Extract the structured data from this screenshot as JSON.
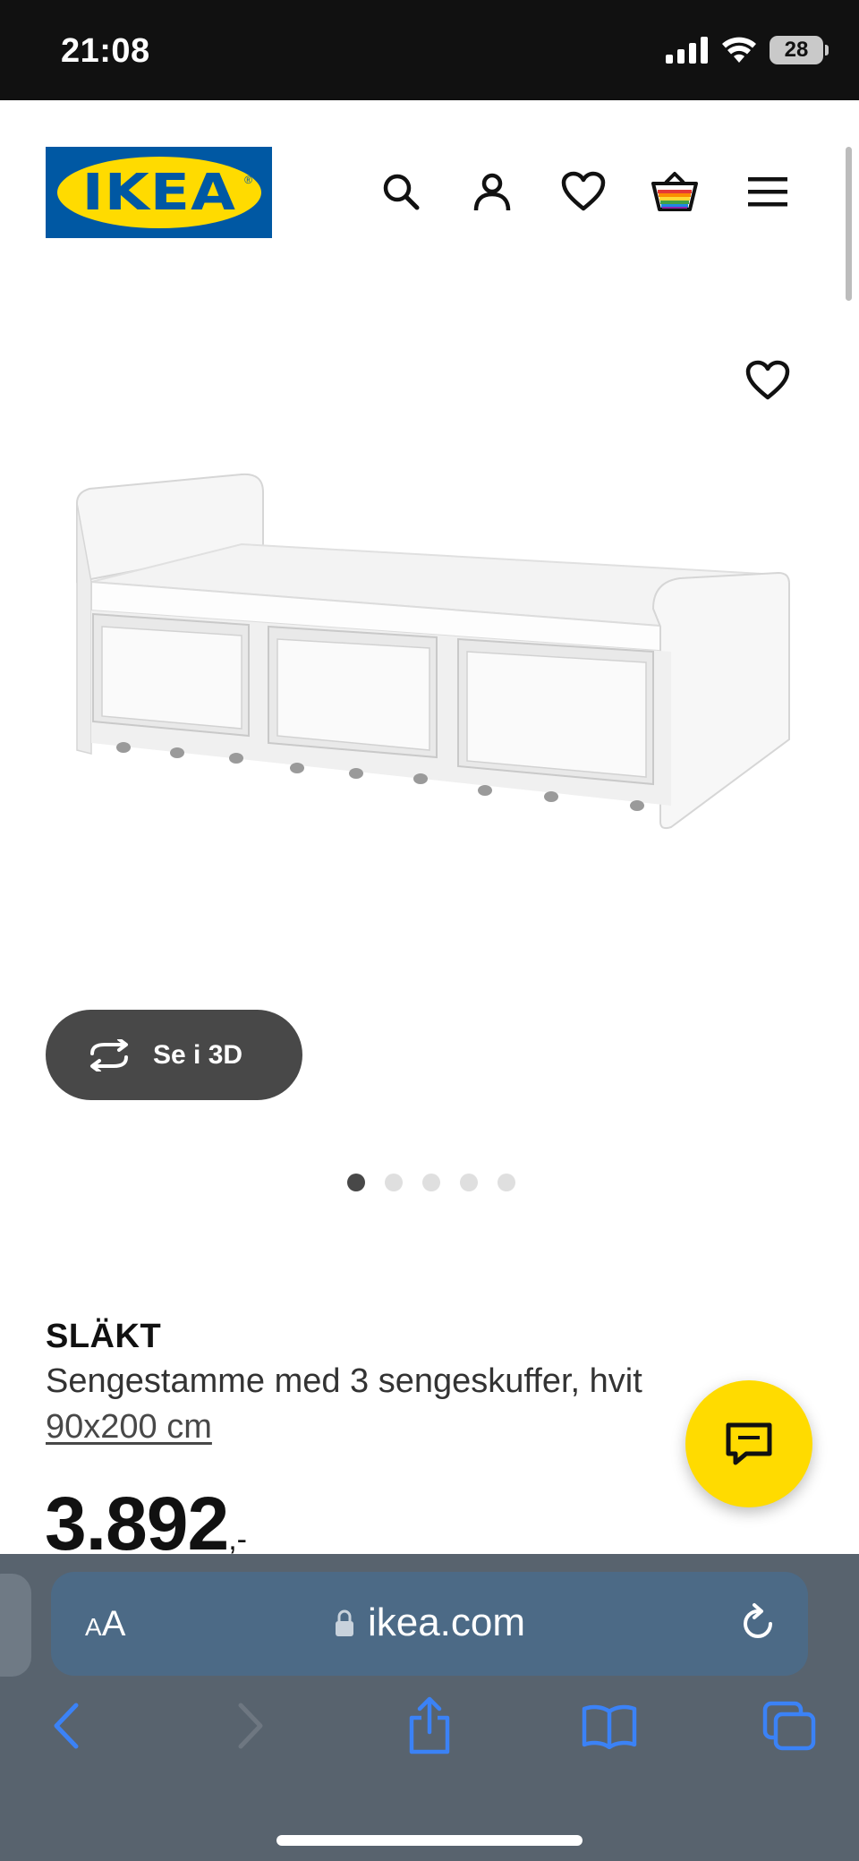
{
  "status_bar": {
    "time": "21:08",
    "battery": "28"
  },
  "header": {
    "logo_text": "IKEA",
    "icons": [
      "search-icon",
      "account-icon",
      "heart-icon",
      "basket-icon",
      "menu-icon"
    ]
  },
  "gallery": {
    "view_3d_label": "Se i 3D",
    "dot_count": 5,
    "active_dot": 0
  },
  "product": {
    "name": "SLÄKT",
    "description": "Sengestamme med 3 sengeskuffer, hvit",
    "size": "90x200 cm",
    "price": "3.892",
    "price_suffix": ",-"
  },
  "browser": {
    "aa_label_small": "A",
    "aa_label_large": "A",
    "url": "ikea.com"
  },
  "colors": {
    "ikea_blue": "#0058a3",
    "ikea_yellow": "#ffdb00",
    "safari_accent": "#3b82f6"
  }
}
